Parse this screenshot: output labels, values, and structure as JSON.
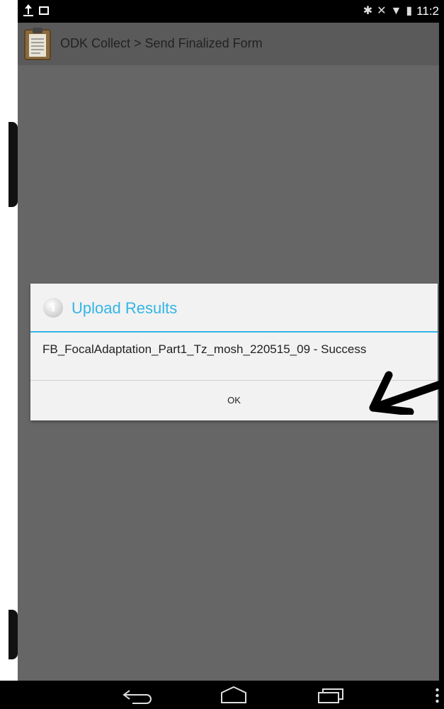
{
  "status_bar": {
    "time": "11:2",
    "left_icons": [
      "upload-icon",
      "image-icon"
    ],
    "right_icons": [
      "bluetooth-icon",
      "mute-icon",
      "wifi-icon",
      "battery-icon"
    ]
  },
  "action_bar": {
    "title": "ODK Collect > Send Finalized Form",
    "icon": "clipboard-icon"
  },
  "dialog": {
    "title": "Upload Results",
    "title_icon": "info-icon",
    "message": "FB_FocalAdaptation_Part1_Tz_mosh_220515_09 - Success",
    "ok_label": "OK",
    "accent_color": "#33b5e5"
  },
  "nav_bar": {
    "icons": [
      "back-icon",
      "home-icon",
      "recent-apps-icon",
      "menu-icon"
    ]
  }
}
